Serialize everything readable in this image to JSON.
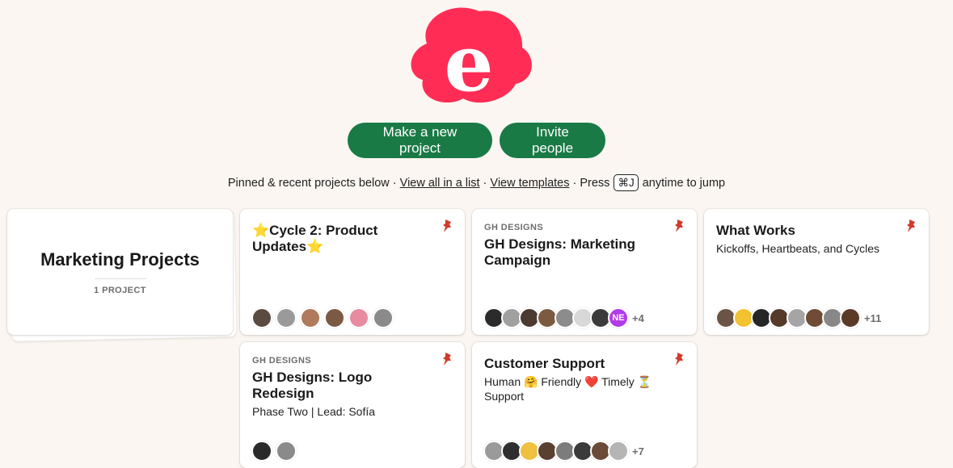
{
  "logo": {
    "letter": "e",
    "color": "#ff2d55"
  },
  "actions": {
    "new_project": "Make a new project",
    "invite": "Invite people"
  },
  "hint": {
    "prefix": "Pinned & recent projects below · ",
    "view_all": "View all in a list",
    "sep": " · ",
    "view_templates": "View templates",
    "press": " · Press ",
    "shortcut": "⌘J",
    "suffix": " anytime to jump"
  },
  "stack": {
    "title": "Marketing Projects",
    "count": "1 PROJECT"
  },
  "projects": [
    {
      "title": "⭐Cycle 2: Product Updates⭐",
      "eyebrow": "",
      "desc": "",
      "avatars": [
        "#5a4a3f",
        "#9a9a9a",
        "#b07a5d",
        "#7b5a44",
        "#e88aa0",
        "#8a8a8a"
      ],
      "more": ""
    },
    {
      "title": "GH Designs: Marketing Campaign",
      "eyebrow": "GH DESIGNS",
      "desc": "",
      "avatars": [
        "#2b2b2b",
        "#a0a0a0",
        "#4a3a30",
        "#7a5a40",
        "#8c8c8c",
        "#d8d8d8",
        "#3b3b3b"
      ],
      "badge": "NE",
      "more": "+4"
    },
    {
      "title": "What Works",
      "eyebrow": "",
      "desc": "Kickoffs, Heartbeats, and Cycles",
      "avatars": [
        "#6a5446",
        "#f2c230",
        "#262626",
        "#553a2a",
        "#a5a5a5",
        "#704c36",
        "#888888",
        "#5c3a28"
      ],
      "more": "+11"
    },
    {
      "title": "GH Designs: Logo Redesign",
      "eyebrow": "GH DESIGNS",
      "desc": "Phase Two | Lead: Sofía",
      "avatars": [
        "#2a2a2a",
        "#8a8a8a"
      ],
      "more": ""
    },
    {
      "title": "Customer Support",
      "eyebrow": "",
      "desc": "Human 🤗 Friendly ❤️ Timely ⏳ Support",
      "avatars": [
        "#9a9a9a",
        "#2f2f2f",
        "#f0c040",
        "#5a4030",
        "#7c7c7c",
        "#3a3a3a",
        "#6a4a38",
        "#b5b5b5"
      ],
      "more": "+7"
    }
  ]
}
